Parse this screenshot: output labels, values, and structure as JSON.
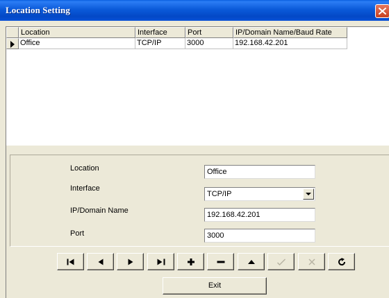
{
  "window": {
    "title": "Location Setting"
  },
  "grid": {
    "columns": [
      "Location",
      "Interface",
      "Port",
      "IP/Domain Name/Baud Rate"
    ],
    "rows": [
      [
        "Office",
        "TCP/IP",
        "3000",
        "192.168.42.201"
      ]
    ]
  },
  "form": {
    "location": {
      "label": "Location",
      "value": "Office"
    },
    "interface": {
      "label": "Interface",
      "value": "TCP/IP"
    },
    "ip": {
      "label": "IP/Domain Name",
      "value": "192.168.42.201"
    },
    "port": {
      "label": "Port",
      "value": "3000"
    }
  },
  "navigator": {
    "buttons": [
      "first-icon",
      "prior-icon",
      "next-icon",
      "last-icon",
      "insert-icon",
      "delete-icon",
      "edit-icon",
      "post-icon",
      "cancel-icon",
      "refresh-icon"
    ],
    "disabled": [
      "post-icon",
      "cancel-icon"
    ]
  },
  "exit_label": "Exit",
  "colors": {
    "title_bar": "#0b5ad9",
    "face": "#ece9d8",
    "close": "#c8401e"
  }
}
